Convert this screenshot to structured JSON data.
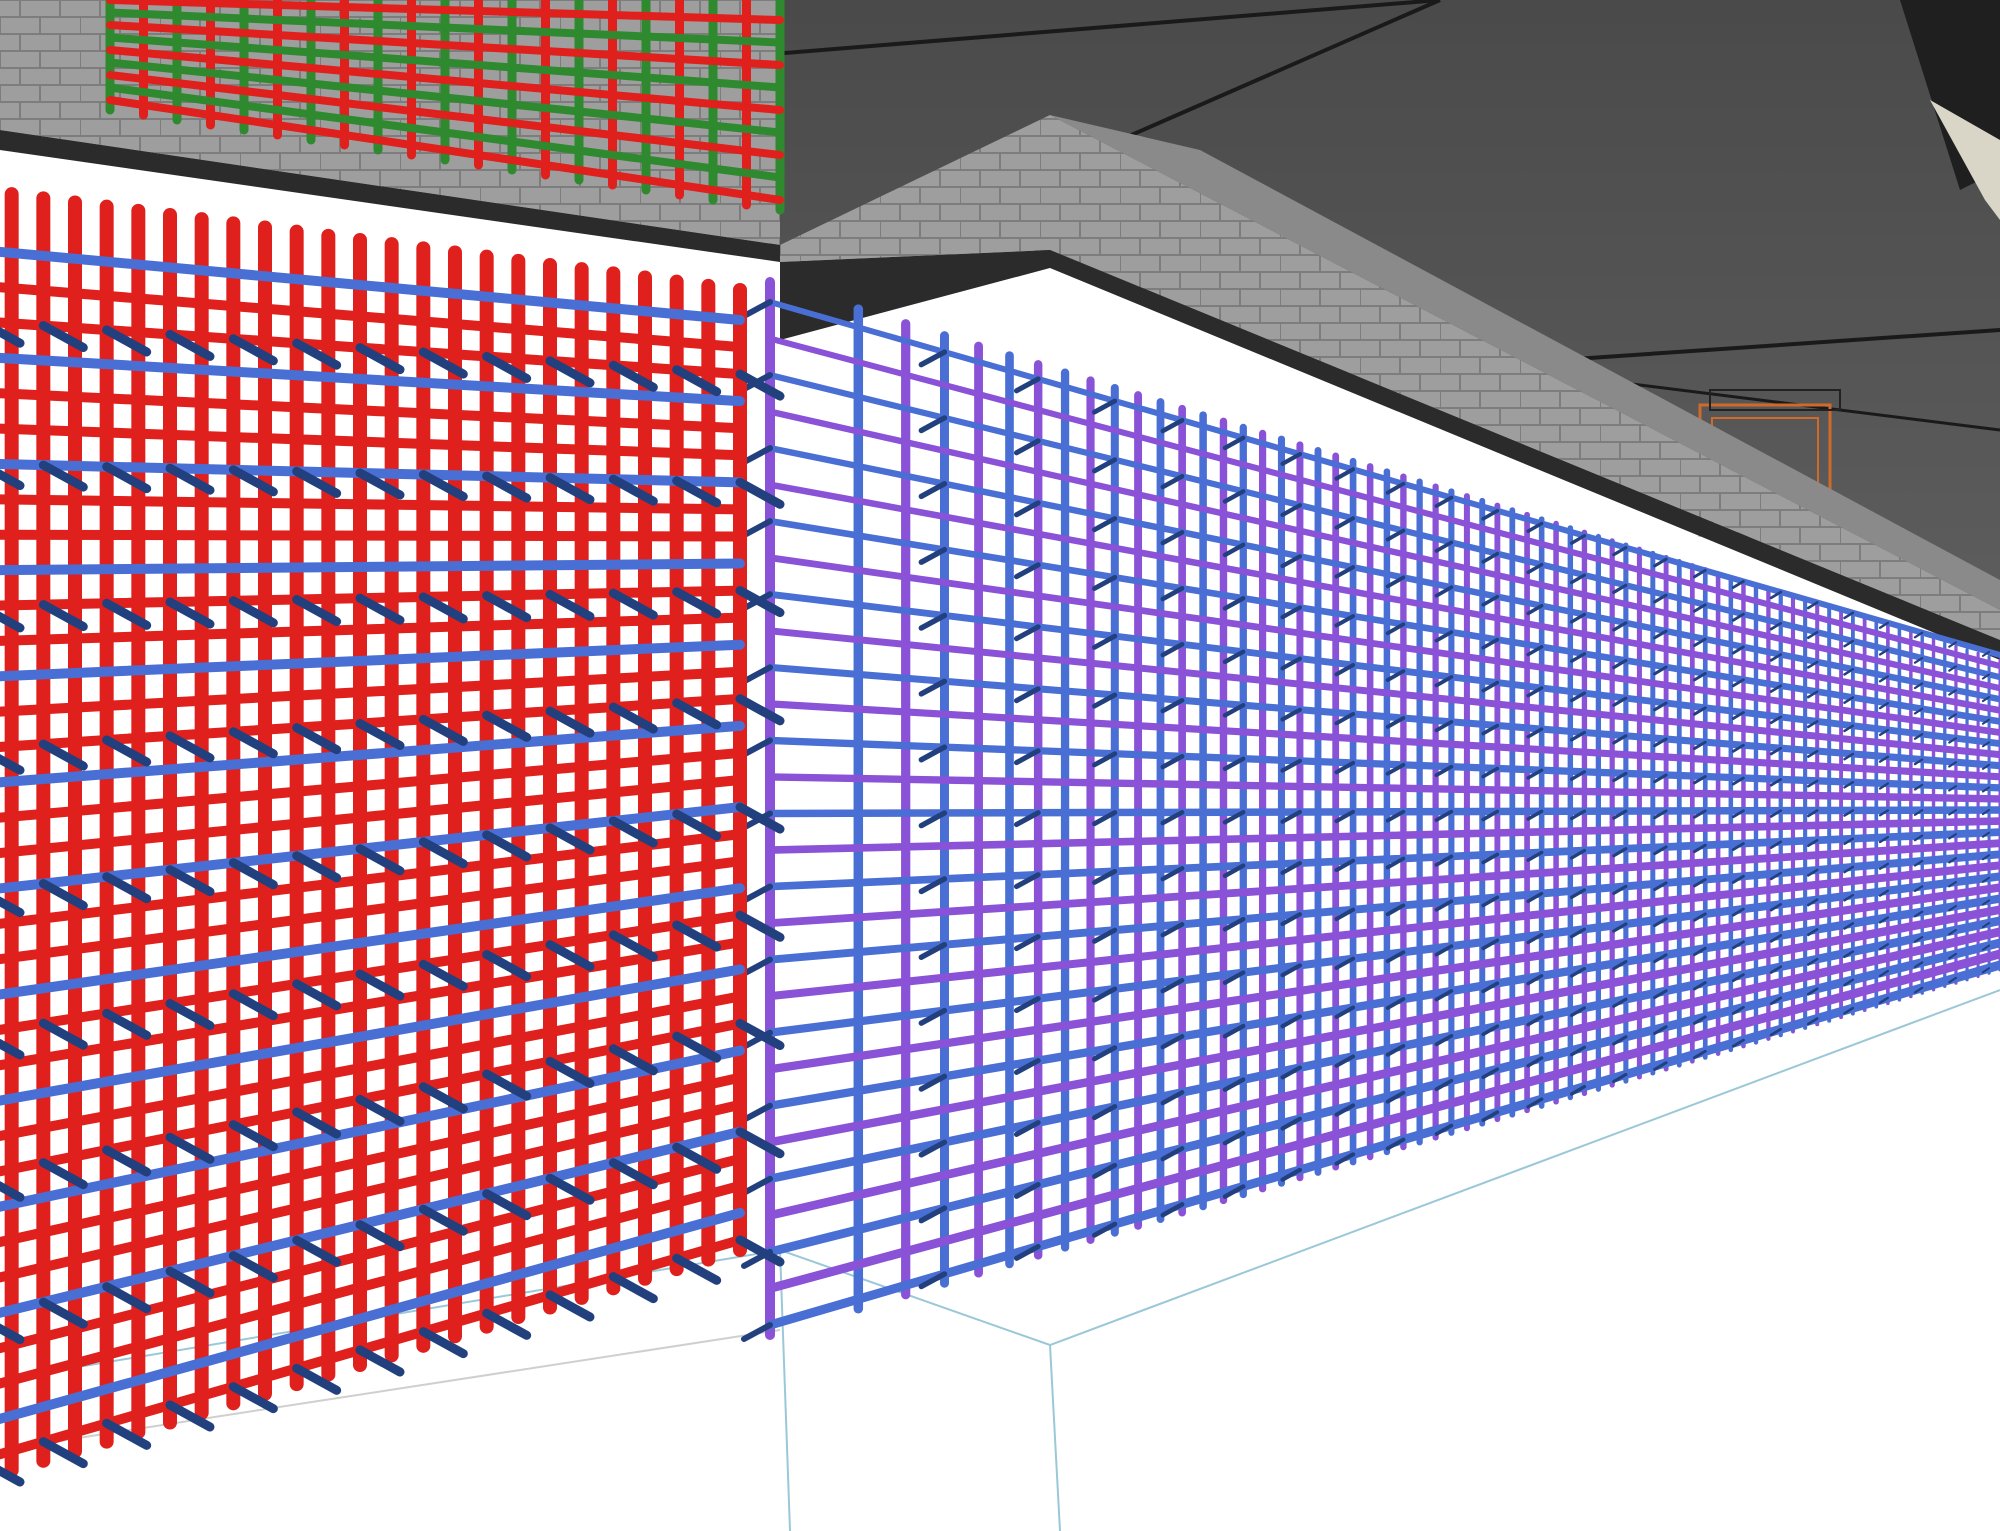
{
  "viewport": {
    "view": "3d-perspective",
    "render_style": "shaded",
    "has_visible_text": false
  },
  "scene": {
    "elements": [
      {
        "name": "ceiling-slab",
        "kind": "slab"
      },
      {
        "name": "block-wall-beam-upper",
        "kind": "masonry-beam"
      },
      {
        "name": "block-wall-beam-lower",
        "kind": "masonry-beam"
      },
      {
        "name": "rebar-cage-upper",
        "kind": "rebar-cage"
      },
      {
        "name": "rebar-cage-left",
        "kind": "rebar-cage"
      },
      {
        "name": "rebar-cage-right",
        "kind": "rebar-cage"
      },
      {
        "name": "concrete-footing",
        "kind": "footing-outline"
      },
      {
        "name": "door-frame",
        "kind": "door"
      }
    ]
  },
  "colors": {
    "ceiling": "#595959",
    "ceiling_dark": "#333333",
    "masonry": "#9e9e9e",
    "masonry_mortar": "#7d7d7d",
    "rebar_red": "#e0201c",
    "rebar_red_dark": "#9c0f0c",
    "rebar_blue": "#4a6fd4",
    "rebar_blue_dark": "#23407e",
    "rebar_purple": "#8a52d6",
    "rebar_green": "#2f8a2f",
    "ground": "#ffffff",
    "guide_lines": "#9bc8d8",
    "door_frame": "#d06a2a"
  },
  "icons": {
    "door": "door-frame-icon"
  }
}
